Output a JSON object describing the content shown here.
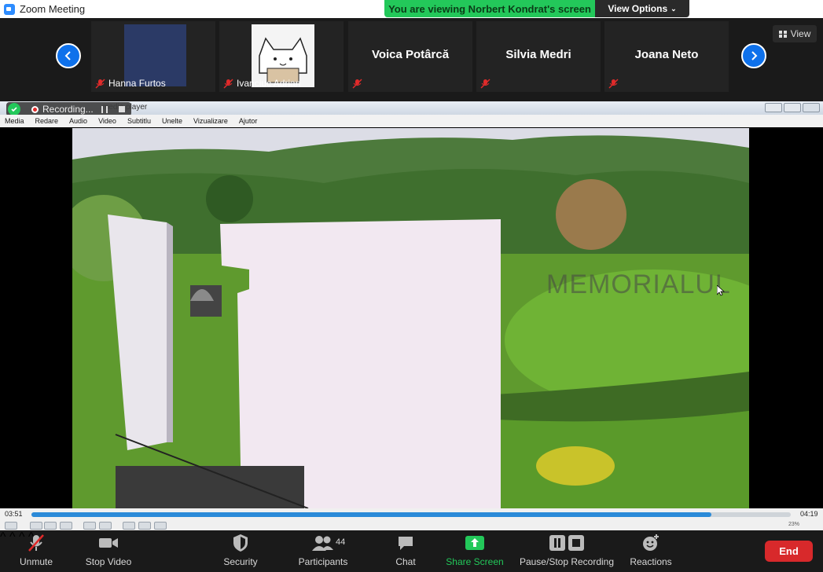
{
  "window": {
    "title": "Zoom Meeting"
  },
  "banner": {
    "viewing_text": "You are viewing Norbert Kondrat's screen",
    "view_options_label": "View Options"
  },
  "gallery": {
    "view_label": "View",
    "participants": [
      {
        "name": "Hanna Furtos",
        "has_video": true
      },
      {
        "name": "Ivanciuc Adrian",
        "has_video": true
      },
      {
        "name": "Voica Potârcă",
        "has_video": false
      },
      {
        "name": "Silvia Medri",
        "has_video": false
      },
      {
        "name": "Joana Neto",
        "has_video": false
      }
    ]
  },
  "recording": {
    "status_label": "Recording..."
  },
  "player": {
    "window_title_fragment": "media player",
    "menu": [
      "Media",
      "Redare",
      "Audio",
      "Video",
      "Subtitlu",
      "Unelte",
      "Vizualizare",
      "Ajutor"
    ],
    "elapsed": "03:51",
    "total": "04:19",
    "progress": 0.895,
    "watermark": "MEMORIALUL",
    "volume": "23%"
  },
  "toolbar": {
    "unmute": "Unmute",
    "stop_video": "Stop Video",
    "security": "Security",
    "participants": "Participants",
    "participant_count": "44",
    "chat": "Chat",
    "share_screen": "Share Screen",
    "pause_stop_recording": "Pause/Stop Recording",
    "reactions": "Reactions",
    "end": "End"
  },
  "colors": {
    "accent": "#0e71eb",
    "share_green": "#23c85a",
    "end_red": "#d8292b"
  }
}
